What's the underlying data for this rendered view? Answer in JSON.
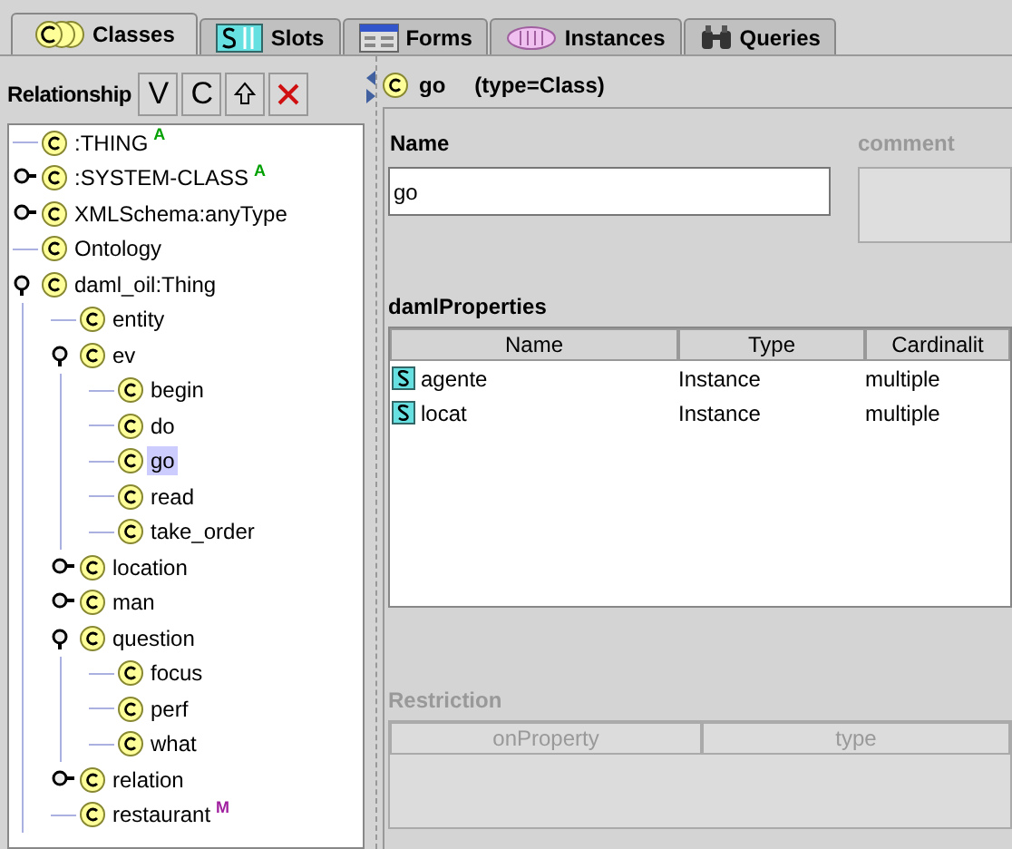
{
  "tabs": [
    {
      "label": "Classes",
      "selected": true
    },
    {
      "label": "Slots",
      "selected": false
    },
    {
      "label": "Forms",
      "selected": false
    },
    {
      "label": "Instances",
      "selected": false
    },
    {
      "label": "Queries",
      "selected": false
    }
  ],
  "left": {
    "title": "Relationship",
    "buttons": [
      {
        "kind": "text",
        "label": "V"
      },
      {
        "kind": "text",
        "label": "C"
      },
      {
        "kind": "up"
      },
      {
        "kind": "delete"
      }
    ],
    "tree": [
      {
        "label": ":THING",
        "badge": {
          "text": "A",
          "color": "#00a000"
        }
      },
      {
        "label": ":SYSTEM-CLASS",
        "expanded": false,
        "badge": {
          "text": "A",
          "color": "#00a000"
        }
      },
      {
        "label": "XMLSchema:anyType",
        "expanded": false
      },
      {
        "label": "Ontology"
      },
      {
        "label": "daml_oil:Thing",
        "expanded": true,
        "children": [
          {
            "label": "entity"
          },
          {
            "label": "ev",
            "expanded": true,
            "children": [
              {
                "label": "begin",
                "selected": false
              },
              {
                "label": "do",
                "selected": false
              },
              {
                "label": "go",
                "selected": true
              },
              {
                "label": "read",
                "selected": false
              },
              {
                "label": "take_order",
                "selected": false
              }
            ]
          },
          {
            "label": "location",
            "expanded": false
          },
          {
            "label": "man",
            "expanded": false
          },
          {
            "label": "question",
            "expanded": true,
            "children": [
              {
                "label": "focus"
              },
              {
                "label": "perf"
              },
              {
                "label": "what"
              }
            ]
          },
          {
            "label": "relation",
            "expanded": false
          },
          {
            "label": "restaurant",
            "badge": {
              "text": "M",
              "color": "#a020a0"
            }
          }
        ]
      }
    ]
  },
  "right": {
    "header": {
      "name": "go",
      "type": "(type=Class)"
    },
    "name_label": "Name",
    "name_value": "go",
    "comment_label": "comment",
    "properties": {
      "title": "damlProperties",
      "columns": [
        "Name",
        "Type",
        "Cardinalit"
      ],
      "rows": [
        {
          "name": "agente",
          "type": "Instance",
          "cardinality": "multiple"
        },
        {
          "name": "locat",
          "type": "Instance",
          "cardinality": "multiple"
        }
      ]
    },
    "restriction": {
      "title": "Restriction",
      "disabled": true,
      "columns": [
        "onProperty",
        "type"
      ]
    }
  }
}
